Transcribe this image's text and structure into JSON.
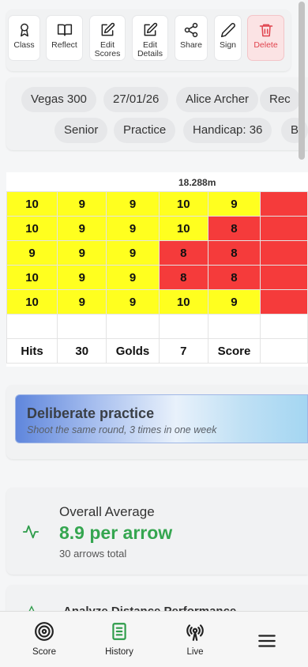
{
  "toolbar": {
    "buttons": [
      {
        "label": "Class",
        "icon": "award-icon"
      },
      {
        "label": "Reflect",
        "icon": "book-open-icon"
      },
      {
        "label": "Edit\nScores",
        "icon": "edit-icon"
      },
      {
        "label": "Edit\nDetails",
        "icon": "edit-icon"
      },
      {
        "label": "Share",
        "icon": "share-icon"
      },
      {
        "label": "Sign",
        "icon": "pen-icon"
      },
      {
        "label": "Delete",
        "icon": "trash-icon"
      }
    ]
  },
  "tags": {
    "row1": [
      "Vegas 300",
      "27/01/26",
      "Alice Archer",
      "Rec"
    ],
    "row2": [
      "Senior",
      "Practice",
      "Handicap: 36",
      "B"
    ]
  },
  "scorecard": {
    "distance": "18.288m",
    "ends": [
      [
        "10",
        "9",
        "9",
        "10",
        "9"
      ],
      [
        "10",
        "9",
        "9",
        "10",
        "8"
      ],
      [
        "9",
        "9",
        "9",
        "8",
        "8"
      ],
      [
        "10",
        "9",
        "9",
        "8",
        "8"
      ],
      [
        "10",
        "9",
        "9",
        "10",
        "9"
      ]
    ],
    "footer": [
      "Hits",
      "30",
      "Golds",
      "7",
      "Score"
    ]
  },
  "deliberate_practice": {
    "title": "Deliberate practice",
    "subtitle": "Shoot the same round, 3 times in one week"
  },
  "overall_average": {
    "title": "Overall Average",
    "value": "8.9 per arrow",
    "total": "30 arrows total"
  },
  "analyze": {
    "title": "Analyze Distance Performance"
  },
  "bottom_nav": {
    "items": [
      {
        "label": "Score",
        "icon": "target-icon"
      },
      {
        "label": "History",
        "icon": "clipboard-icon"
      },
      {
        "label": "Live",
        "icon": "broadcast-icon"
      },
      {
        "label": "",
        "icon": "menu-icon"
      }
    ]
  },
  "colors": {
    "accent_green": "#35a650",
    "gold": "#ffff1f",
    "red": "#f53b3b",
    "danger": "#e0434d"
  }
}
